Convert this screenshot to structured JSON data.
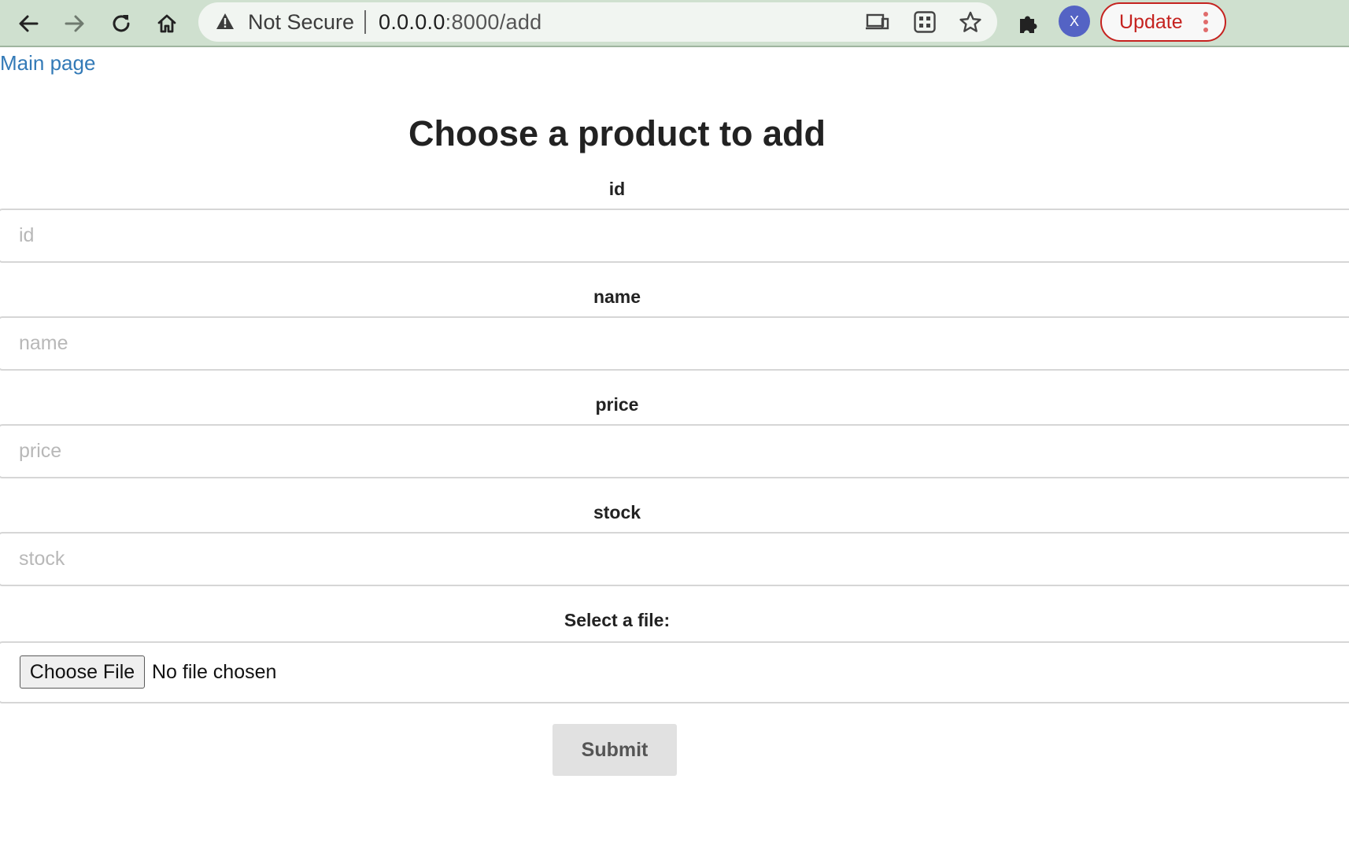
{
  "browser": {
    "security_label": "Not Secure",
    "url_host": "0.0.0.0",
    "url_path": ":8000/add",
    "avatar_initial": "X",
    "update_label": "Update",
    "icons": {
      "back": "arrow-left-icon",
      "forward": "arrow-right-icon",
      "reload": "reload-icon",
      "home": "home-icon",
      "warning": "warning-triangle-icon",
      "cast": "cast-devices-icon",
      "qr": "qr-code-icon",
      "bookmark": "star-icon",
      "extensions": "puzzle-piece-icon",
      "menu": "kebab-menu-icon"
    },
    "colors": {
      "toolbar": "#cfe0cf",
      "avatar": "#5463c4",
      "update": "#c5221f"
    }
  },
  "page": {
    "main_link": "Main page",
    "title": "Choose a product to add",
    "fields": [
      {
        "label": "id",
        "placeholder": "id"
      },
      {
        "label": "name",
        "placeholder": "name"
      },
      {
        "label": "price",
        "placeholder": "price"
      },
      {
        "label": "stock",
        "placeholder": "stock"
      }
    ],
    "file_field": {
      "label": "Select a file:",
      "button_label": "Choose File",
      "status": "No file chosen"
    },
    "submit_label": "Submit",
    "colors": {
      "link": "#337ab7",
      "submit_bg": "#e1e1e1"
    }
  }
}
